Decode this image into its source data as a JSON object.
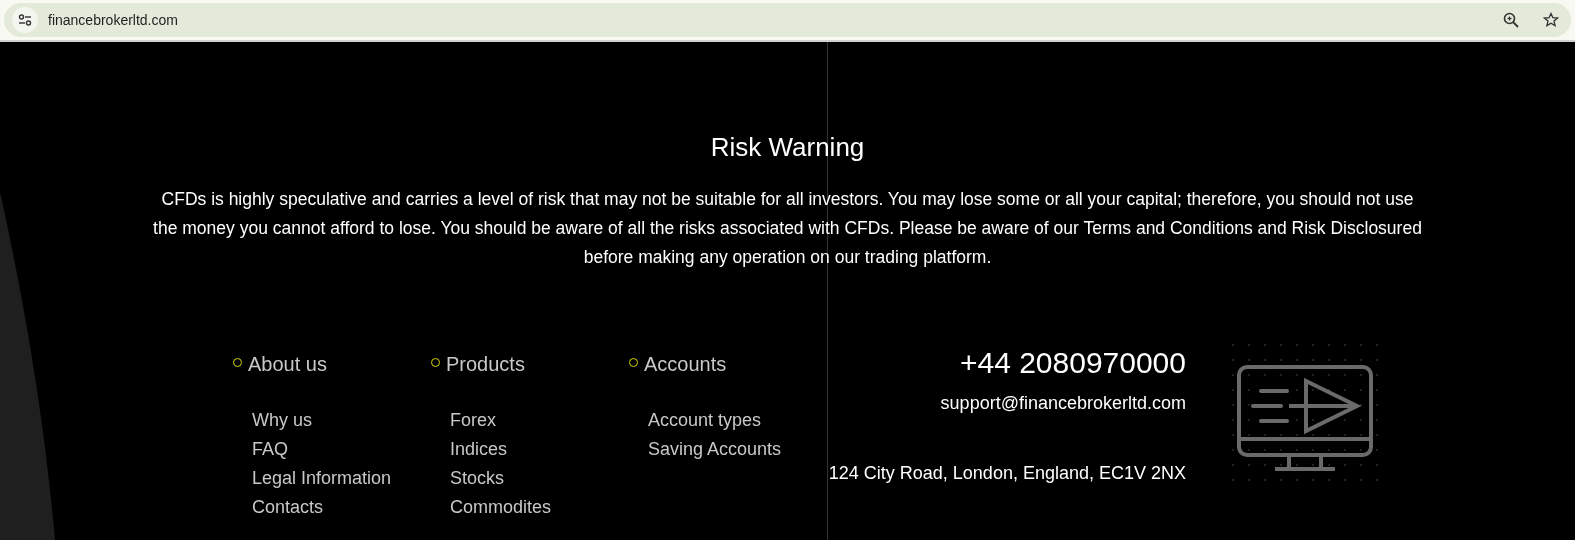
{
  "address_bar": {
    "url": "financebrokerltd.com"
  },
  "risk_warning": {
    "title": "Risk Warning",
    "text": "CFDs is highly speculative and carries a level of risk that may not be suitable for all investors. You may lose some or all your capital; therefore, you should not use the money you cannot afford to lose. You should be aware of all the risks associated with CFDs. Please be aware of our Terms and Conditions and Risk Disclosured before making any operation on our trading platform."
  },
  "footer_columns": [
    {
      "heading": "About us",
      "links": [
        "Why us",
        "FAQ",
        "Legal Information",
        "Contacts"
      ]
    },
    {
      "heading": "Products",
      "links": [
        "Forex",
        "Indices",
        "Stocks",
        "Commodites"
      ]
    },
    {
      "heading": "Accounts",
      "links": [
        "Account types",
        "Saving Accounts"
      ]
    }
  ],
  "contact": {
    "phone": "+44 2080970000",
    "email": "support@financebrokerltd.com",
    "address": "124 City Road, London, England, EC1V 2NX"
  }
}
